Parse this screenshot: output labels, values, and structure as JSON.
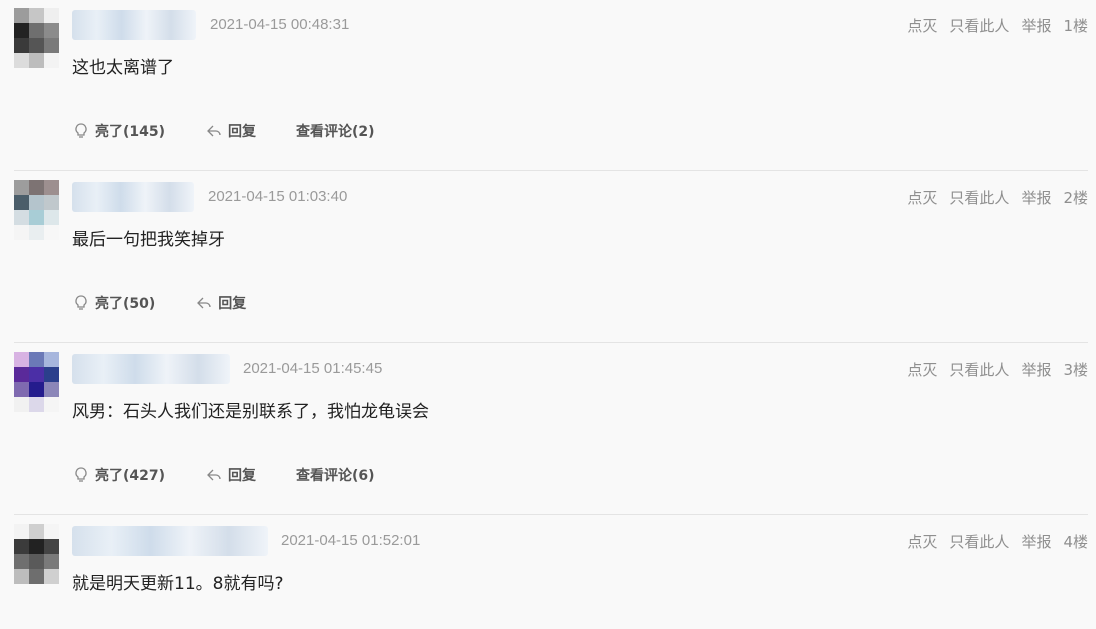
{
  "comments": [
    {
      "time": "2021-04-15 00:48:31",
      "text": "这也太离谱了",
      "actions": [
        "点灭",
        "只看此人",
        "举报"
      ],
      "floor": "1楼",
      "like_label": "亮了(145)",
      "reply_label": "回复",
      "view_comments_label": "查看评论(2)"
    },
    {
      "time": "2021-04-15 01:03:40",
      "text": "最后一句把我笑掉牙",
      "actions": [
        "点灭",
        "只看此人",
        "举报"
      ],
      "floor": "2楼",
      "like_label": "亮了(50)",
      "reply_label": "回复"
    },
    {
      "time": "2021-04-15 01:45:45",
      "text": "风男：石头人我们还是别联系了，我怕龙龟误会",
      "actions": [
        "点灭",
        "只看此人",
        "举报"
      ],
      "floor": "3楼",
      "like_label": "亮了(427)",
      "reply_label": "回复",
      "view_comments_label": "查看评论(6)"
    },
    {
      "time": "2021-04-15 01:52:01",
      "text": "就是明天更新11。8就有吗?",
      "actions": [
        "点灭",
        "只看此人",
        "举报"
      ],
      "floor": "4楼"
    }
  ],
  "icons": {
    "like": "lightbulb-icon",
    "reply": "reply-arrow-icon"
  }
}
